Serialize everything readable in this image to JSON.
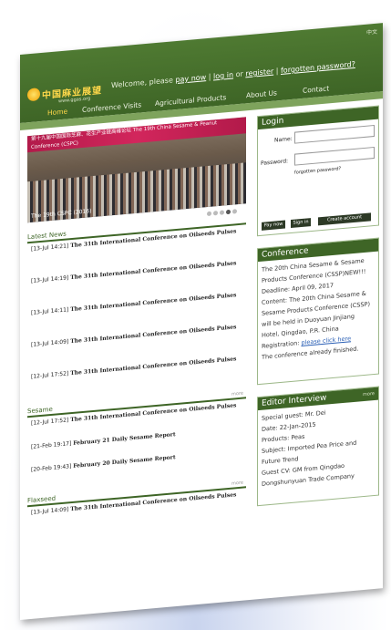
{
  "header": {
    "lang": "中文",
    "logo_cn": "中国麻业展望",
    "logo_url": "www.ggas.org",
    "welcome": "Welcome, please",
    "pay_now": "pay now",
    "sep1": "|",
    "log_in": "log in",
    "or": "or",
    "register": "register",
    "sep2": "|",
    "forgotten": "forgotten password?"
  },
  "nav": [
    "Home",
    "Conference Visits",
    "Agricultural Products",
    "About Us",
    "Contact"
  ],
  "banner": {
    "strip_text": "第十九届中国国际芝麻、花生产业链高峰论坛  The 19th China Sesame & Peanut Conference (CSPC)",
    "caption": "The 19th CSPC (2016)"
  },
  "latest_news": {
    "title": "Latest News",
    "items": [
      {
        "time": "[13-Jul 14:21]",
        "text": "The 31th International Conference on Oilseeds Pulses"
      },
      {
        "time": "[13-Jul 14:19]",
        "text": "The 31th International Conference on Oilseeds Pulses"
      },
      {
        "time": "[13-Jul 14:11]",
        "text": "The 31th International Conference on Oilseeds Pulses"
      },
      {
        "time": "[13-Jul 14:09]",
        "text": "The 31th International Conference on Oilseeds Pulses"
      },
      {
        "time": "[12-Jul 17:52]",
        "text": "The 31th International Conference on Oilseeds Pulses"
      }
    ]
  },
  "sesame": {
    "title": "Sesame",
    "more": "more",
    "items": [
      {
        "time": "[12-Jul 17:52]",
        "text": "The 31th International Conference on Oilseeds Pulses"
      },
      {
        "time": "[21-Feb 19:17]",
        "text": "February 21 Daily Sesame Report"
      },
      {
        "time": "[20-Feb 19:43]",
        "text": "February 20 Daily Sesame Report"
      }
    ]
  },
  "flaxseed": {
    "title": "Flaxseed",
    "more": "more",
    "items": [
      {
        "time": "[13-Jul 14:09]",
        "text": "The 31th International Conference on Oilseeds Pulses"
      }
    ]
  },
  "login": {
    "title": "Login",
    "name_label": "Name:",
    "password_label": "Password:",
    "forgotten": "forgotten password?",
    "pay_now": "Pay now",
    "sign_in": "Sign in",
    "create": "Create account"
  },
  "conference": {
    "title": "Conference",
    "lines": [
      "The 20th China Sesame & Sesame",
      "Products Conference (CSSP)NEW!!!",
      "Deadline: April 09, 2017",
      "Content: The 20th China Sesame &",
      "Sesame Products Conference (CSSP)",
      "will be held in Duoyuan Jinjiang",
      "Hotel, Qingdao, P.R. China"
    ],
    "reg_label": "Registration:",
    "reg_link": "please click here",
    "finished": "The conference already finished."
  },
  "interview": {
    "title": "Editor Interview",
    "more": "more",
    "lines": [
      "Special guest: Mr. Dei",
      "Date: 22-Jan-2015",
      "Products: Peas",
      "Subject: Imported Pea Price and",
      "Future Trend",
      "Guest CV: GM from Qingdao",
      "Dongshunyuan Trade Company"
    ]
  }
}
